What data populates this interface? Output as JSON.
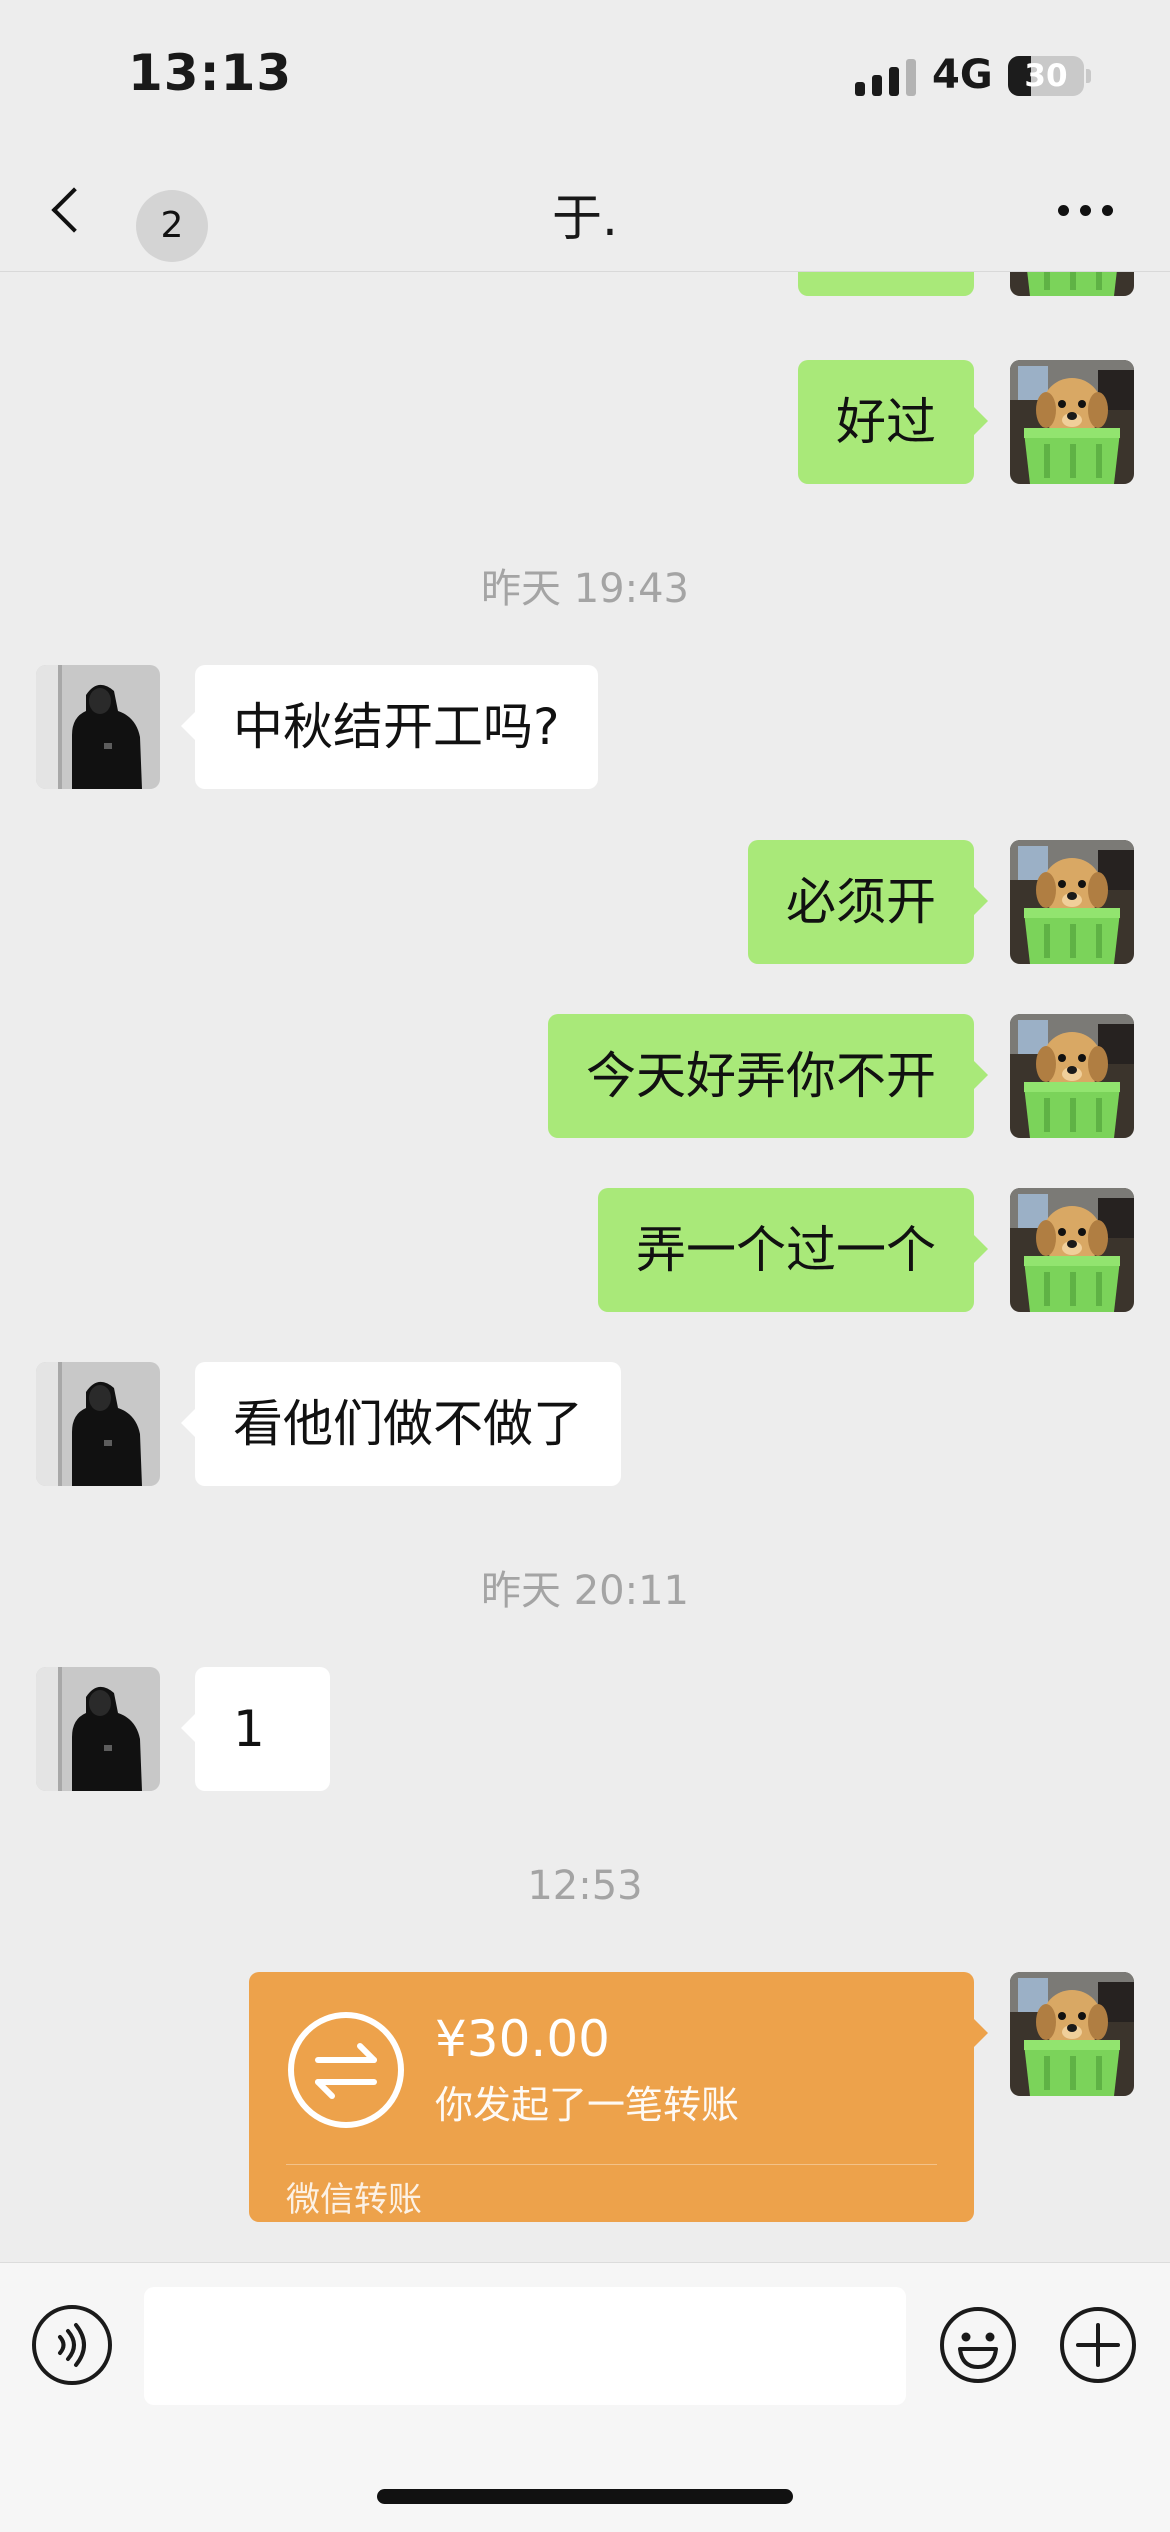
{
  "status_bar": {
    "time": "13:13",
    "network": "4G",
    "battery_level": "30",
    "battery_fraction": 0.3
  },
  "nav": {
    "unread_count": "2",
    "title": "于.",
    "back_icon": "chevron-left-icon",
    "more_icon": "more-dots-icon"
  },
  "messages": [
    {
      "type": "out",
      "text": "好过"
    },
    {
      "type": "time",
      "text": "昨天 19:43"
    },
    {
      "type": "in",
      "text": "中秋结开工吗?"
    },
    {
      "type": "out",
      "text": "必须开"
    },
    {
      "type": "out",
      "text": "今天好弄你不开"
    },
    {
      "type": "out",
      "text": "弄一个过一个"
    },
    {
      "type": "in",
      "text": "看他们做不做了"
    },
    {
      "type": "time",
      "text": "昨天 20:11"
    },
    {
      "type": "in",
      "text": "1"
    },
    {
      "type": "time",
      "text": "12:53"
    }
  ],
  "transfer": {
    "amount": "¥30.00",
    "description": "你发起了一笔转账",
    "source": "微信转账",
    "color": "#eda24b",
    "icon": "transfer-arrows-icon"
  },
  "input_bar": {
    "placeholder": "",
    "voice_icon": "voice-icon",
    "emoji_icon": "emoji-icon",
    "plus_icon": "plus-circle-icon"
  },
  "colors": {
    "background": "#ededed",
    "outgoing_bubble": "#a9e979",
    "incoming_bubble": "#ffffff",
    "timestamp": "#a4a4a4"
  }
}
